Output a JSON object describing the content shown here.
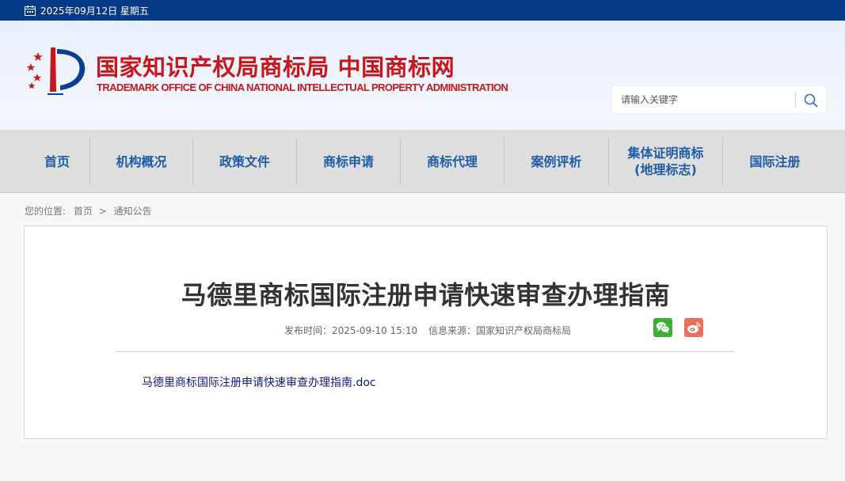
{
  "topbar": {
    "date": "2025年09月12日 星期五"
  },
  "header": {
    "title": "国家知识产权局商标局 中国商标网",
    "subtitle": "TRADEMARK OFFICE OF CHINA NATIONAL INTELLECTUAL PROPERTY ADMINISTRATION"
  },
  "search": {
    "placeholder": "请输入关键字"
  },
  "nav": {
    "items": [
      {
        "label": "首页"
      },
      {
        "label": "机构概况"
      },
      {
        "label": "政策文件"
      },
      {
        "label": "商标申请"
      },
      {
        "label": "商标代理"
      },
      {
        "label": "案例评析"
      },
      {
        "label": "集体证明商标\n(地理标志)"
      },
      {
        "label": "国际注册"
      }
    ]
  },
  "breadcrumb": {
    "prefix": "您的位置:",
    "home": "首页",
    "arrow": ">",
    "current": "通知公告"
  },
  "article": {
    "title": "马德里商标国际注册申请快速审查办理指南",
    "publish_label": "发布时间：",
    "publish_time": "2025-09-10 15:10",
    "source_label": "信息来源：",
    "source": "国家知识产权局商标局",
    "attachment": "马德里商标国际注册申请快速审查办理指南.doc"
  },
  "colors": {
    "topbar": "#063a87",
    "brand_red": "#c8161d",
    "nav_text": "#1d5ca8",
    "nav_bg": "#dedede",
    "wechat": "#3bb035",
    "weibo": "#e6705a",
    "attachment_link": "#15157e"
  },
  "icons": [
    "calendar-icon",
    "search-icon",
    "wechat-icon",
    "weibo-icon",
    "logo-emblem"
  ]
}
